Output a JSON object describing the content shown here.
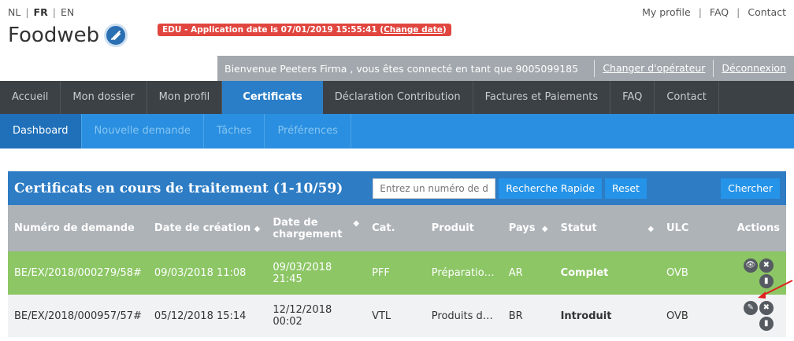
{
  "lang": {
    "nl": "NL",
    "fr": "FR",
    "en": "EN"
  },
  "toplinks": {
    "profile": "My profile",
    "faq": "FAQ",
    "contact": "Contact"
  },
  "logo": {
    "name": "Foodweb"
  },
  "edu": {
    "text": "EDU - Application date is 07/01/2019 15:55:41 (",
    "link": "Change date",
    "close": ")"
  },
  "welcome": {
    "text": "Bienvenue Peeters Firma , vous êtes connecté en tant que 9005099185",
    "change_operator": "Changer d'opérateur",
    "logout": "Déconnexion"
  },
  "mainnav": [
    "Accueil",
    "Mon dossier",
    "Mon profil",
    "Certificats",
    "Déclaration Contribution",
    "Factures et Paiements",
    "FAQ",
    "Contact"
  ],
  "subnav": [
    "Dashboard",
    "Nouvelle demande",
    "Tâches",
    "Préférences"
  ],
  "panel": {
    "title": "Certificats en cours de traitement (1-10/59)",
    "search_placeholder": "Entrez un numéro de d",
    "quick_search": "Recherche Rapide",
    "reset": "Reset",
    "search": "Chercher"
  },
  "table": {
    "headers": [
      "Numéro de demande",
      "Date de création",
      "Date de chargement",
      "Cat.",
      "Produit",
      "Pays",
      "Statut",
      "ULC",
      "Actions"
    ],
    "rows": [
      [
        "BE/EX/2018/000279/58#",
        "09/03/2018 11:08",
        "09/03/2018 21:45",
        "PFF",
        "Préparatio…",
        "AR",
        "Complet",
        "OVB"
      ],
      [
        "BE/EX/2018/000957/57#",
        "05/12/2018 15:14",
        "12/12/2018 00:02",
        "VTL",
        "Produits d…",
        "BR",
        "Introduit",
        "OVB"
      ]
    ]
  },
  "colors": {
    "accent": "#2a7ec8",
    "complete_row": "#8cc665",
    "edu_badge": "#e0463f"
  },
  "icons": {
    "view": "eye-icon",
    "delete": "close-icon",
    "document": "document-icon",
    "edit": "edit-icon"
  }
}
